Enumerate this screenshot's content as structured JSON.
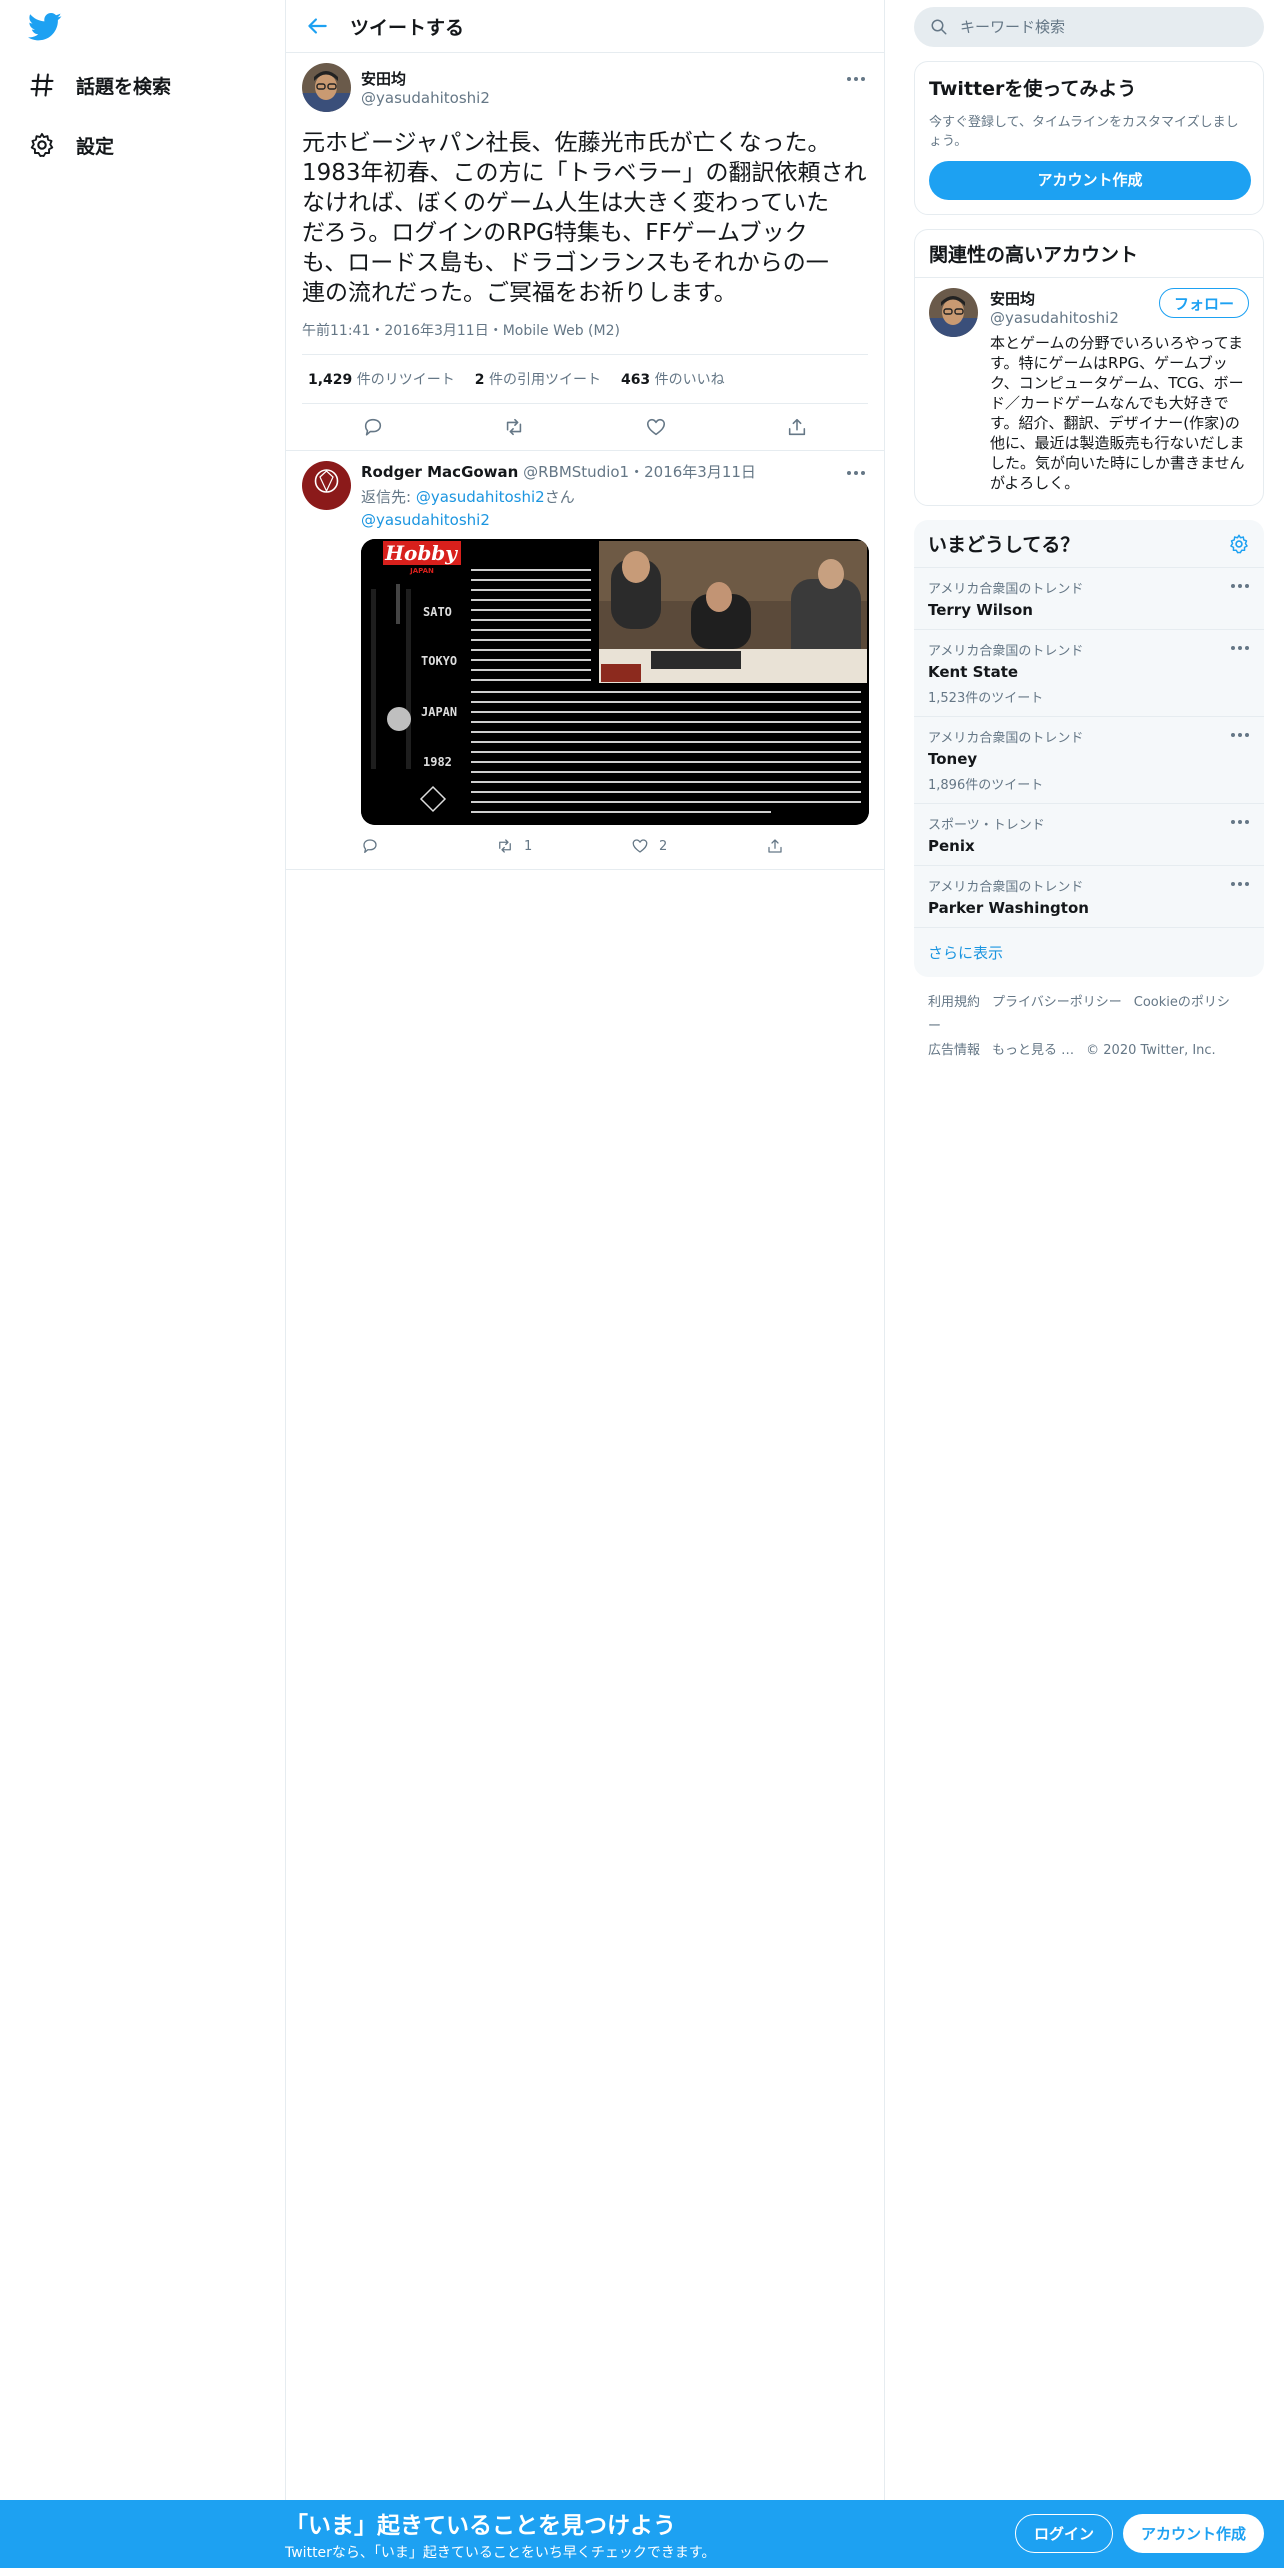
{
  "nav": {
    "items": [
      {
        "label": "話題を検索",
        "icon": "hashtag-icon"
      },
      {
        "label": "設定",
        "icon": "gear-icon"
      }
    ]
  },
  "header": {
    "title": "ツイートする"
  },
  "focal_tweet": {
    "display_name": "安田均",
    "username": "@yasudahitoshi2",
    "text": "元ホビージャパン社長、佐藤光市氏が亡くなった。\n1983年初春、この方に「トラベラー」の翻訳依頼され\nなければ、ぼくのゲーム人生は大きく変わっていた\nだろう。ログインのRPG特集も、FFゲームブック\nも、ロードス島も、ドラゴンランスもそれからの一\n連の流れだった。ご冥福をお祈りします。",
    "meta": "午前11:41・2016年3月11日・Mobile Web (M2)",
    "retweets": "1,429",
    "retweets_label": "件のリツイート",
    "quotes": "2",
    "quotes_label": "件の引用ツイート",
    "likes": "463",
    "likes_label": "件のいいね"
  },
  "reply": {
    "display_name": "Rodger MacGowan",
    "username": "@RBMStudio1",
    "date": "・2016年3月11日",
    "reply_to_label": "返信先: ",
    "reply_to_user": "@yasudahitoshi2",
    "reply_to_suffix": "さん",
    "mention": "@yasudahitoshi2",
    "retweets": "1",
    "likes": "2",
    "image": {
      "brand": "Hobby",
      "brand_sub": "JAPAN",
      "side_words": [
        "SATO",
        "TOKYO",
        "JAPAN",
        "1982"
      ]
    }
  },
  "search": {
    "placeholder": "キーワード検索"
  },
  "signup_card": {
    "title": "Twitterを使ってみよう",
    "desc": "今すぐ登録して、タイムラインをカスタマイズしましょう。",
    "button": "アカウント作成"
  },
  "related": {
    "title": "関連性の高いアカウント",
    "display_name": "安田均",
    "username": "@yasudahitoshi2",
    "follow": "フォロー",
    "bio": "本とゲームの分野でいろいろやってます。特にゲームはRPG、ゲームブック、コンピュータゲーム、TCG、ボード／カードゲームなんでも大好きです。紹介、翻訳、デザイナー(作家)の他に、最近は製造販売も行ないだしました。気が向いた時にしか書きませんがよろしく。"
  },
  "trends": {
    "title": "いまどうしてる？",
    "items": [
      {
        "category": "アメリカ合衆国のトレンド",
        "name": "Terry Wilson",
        "count": ""
      },
      {
        "category": "アメリカ合衆国のトレンド",
        "name": "Kent State",
        "count": "1,523件のツイート"
      },
      {
        "category": "アメリカ合衆国のトレンド",
        "name": "Toney",
        "count": "1,896件のツイート"
      },
      {
        "category": "スポーツ・トレンド",
        "name": "Penix",
        "count": ""
      },
      {
        "category": "アメリカ合衆国のトレンド",
        "name": "Parker Washington",
        "count": ""
      }
    ],
    "show_more": "さらに表示"
  },
  "footer": {
    "links": [
      "利用規約",
      "プライバシーポリシー",
      "Cookieのポリシー",
      "広告情報",
      "もっと見る …",
      "© 2020 Twitter, Inc."
    ]
  },
  "bottom_bar": {
    "title": "「いま」起きていることを見つけよう",
    "subtitle": "Twitterなら、「いま」起きていることをいち早くチェックできます。",
    "login": "ログイン",
    "signup": "アカウント作成"
  },
  "colors": {
    "accent": "#1da1f2",
    "link": "#1b95e0",
    "muted": "#657786",
    "border": "#e6ecf0"
  }
}
